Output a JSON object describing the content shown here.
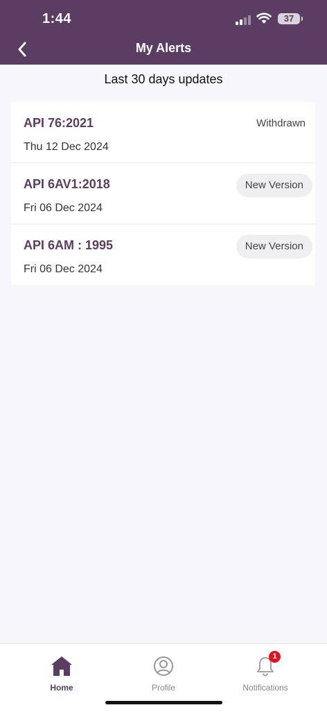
{
  "status_bar": {
    "time": "1:44",
    "battery": "37"
  },
  "header": {
    "title": "My Alerts"
  },
  "section": {
    "title": "Last 30 days updates"
  },
  "alerts": [
    {
      "name": "API 76:2021",
      "date": "Thu 12 Dec 2024",
      "status": "Withdrawn"
    },
    {
      "name": "API 6AV1:2018",
      "date": "Fri 06 Dec 2024",
      "status": "New Version"
    },
    {
      "name": "API 6AM : 1995",
      "date": "Fri 06 Dec 2024",
      "status": "New Version"
    }
  ],
  "tabs": [
    {
      "label": "Home",
      "icon": "home-icon",
      "active": true
    },
    {
      "label": "Profile",
      "icon": "user-icon",
      "active": false
    },
    {
      "label": "Notifications",
      "icon": "bell-icon",
      "active": false,
      "badge": "1"
    }
  ],
  "colors": {
    "brand": "#5b3c63",
    "badge_red": "#e1121d",
    "background": "#f6f6fb"
  }
}
